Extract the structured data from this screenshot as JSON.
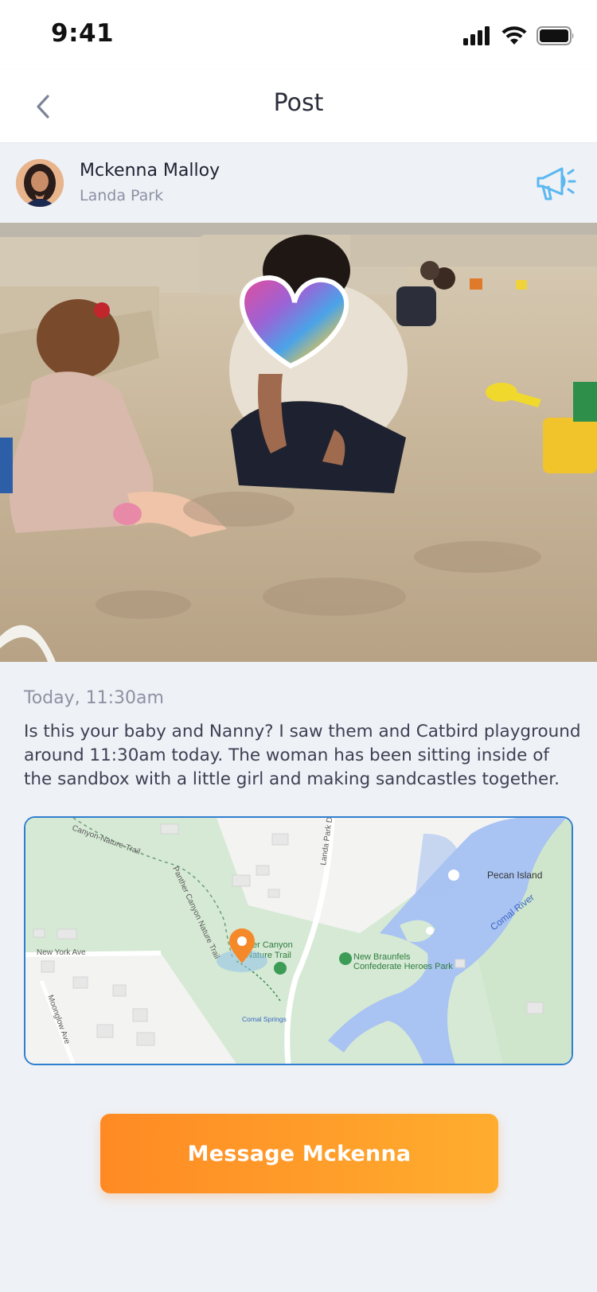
{
  "status_bar": {
    "time": "9:41"
  },
  "nav": {
    "title": "Post"
  },
  "author": {
    "name": "Mckenna Malloy",
    "location": "Landa Park"
  },
  "post": {
    "timestamp": "Today, 11:30am",
    "body": "Is this your baby and Nanny? I saw them and Catbird playground around 11:30am today. The woman has been sitting inside of the sandbox with a little girl and making sandcastles together."
  },
  "map": {
    "labels": {
      "canyon_trail_top": "Canyon-Nature-Trail",
      "panther_trail": "Panther Canyon Nature Trail",
      "landa_park_dr": "Landa Park Dr",
      "pecan_island": "Pecan Island",
      "comal_river": "Comal River",
      "canyon_trail_poi_1": "er Canyon",
      "canyon_trail_poi_2": "Nature Trail",
      "heroes_park_1": "New Braunfels",
      "heroes_park_2": "Confederate Heroes Park",
      "new_york_ave": "New York Ave",
      "moonglow_ave": "Moonglow Ave",
      "comal_springs": "Comal Springs"
    }
  },
  "actions": {
    "message_label": "Message Mckenna"
  },
  "colors": {
    "accent_start": "#ff8a24",
    "accent_end": "#ffad2e",
    "map_border": "#2f7fd0",
    "megaphone": "#5bb8f0"
  },
  "icons": {
    "back": "chevron-left-icon",
    "megaphone": "megaphone-icon",
    "signal": "signal-icon",
    "wifi": "wifi-icon",
    "battery": "battery-icon",
    "map_pin": "map-pin-icon"
  }
}
